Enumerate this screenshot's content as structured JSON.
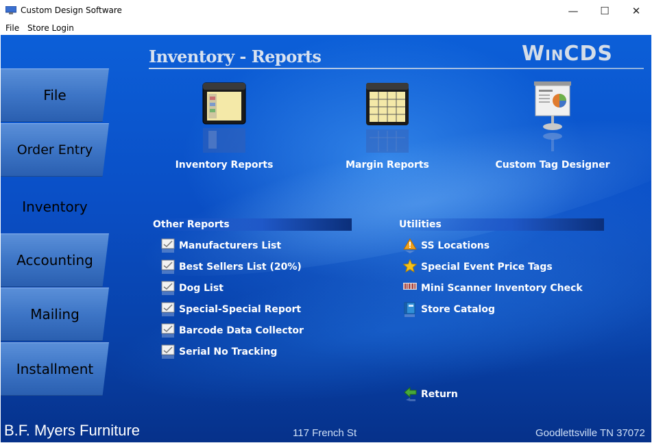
{
  "window": {
    "title": "Custom Design Software",
    "minimize_glyph": "—",
    "maximize_glyph": "☐",
    "close_glyph": "✕"
  },
  "menu": {
    "items": [
      "File",
      "Store Login"
    ]
  },
  "sidebar": {
    "tabs": [
      "File",
      "Order Entry",
      "Inventory",
      "Accounting",
      "Mailing",
      "Installment"
    ],
    "active": "Inventory"
  },
  "header": {
    "title": "Inventory - Reports",
    "brand": "WinCDS"
  },
  "big_buttons": [
    {
      "label": "Inventory Reports",
      "icon": "window-list-icon"
    },
    {
      "label": "Margin Reports",
      "icon": "spreadsheet-icon"
    },
    {
      "label": "Custom Tag Designer",
      "icon": "presentation-chart-icon"
    }
  ],
  "other_reports": {
    "header": "Other Reports",
    "items": [
      "Manufacturers List",
      "Best Sellers List (20%)",
      "Dog List",
      "Special-Special Report",
      "Barcode Data Collector",
      "Serial No Tracking"
    ]
  },
  "utilities": {
    "header": "Utilities",
    "items": [
      {
        "label": "SS Locations",
        "icon": "warning-icon"
      },
      {
        "label": "Special Event Price Tags",
        "icon": "star-icon"
      },
      {
        "label": "Mini Scanner Inventory Check",
        "icon": "barcode-icon"
      },
      {
        "label": "Store Catalog",
        "icon": "book-icon"
      }
    ]
  },
  "return_label": "Return",
  "footer": {
    "store": "B.F. Myers Furniture",
    "address": "117 French St",
    "city": "Goodlettsville TN 37072"
  },
  "colors": {
    "background": "#0a4fc6",
    "tab": "#3d75c6",
    "text": "#ffffff"
  }
}
